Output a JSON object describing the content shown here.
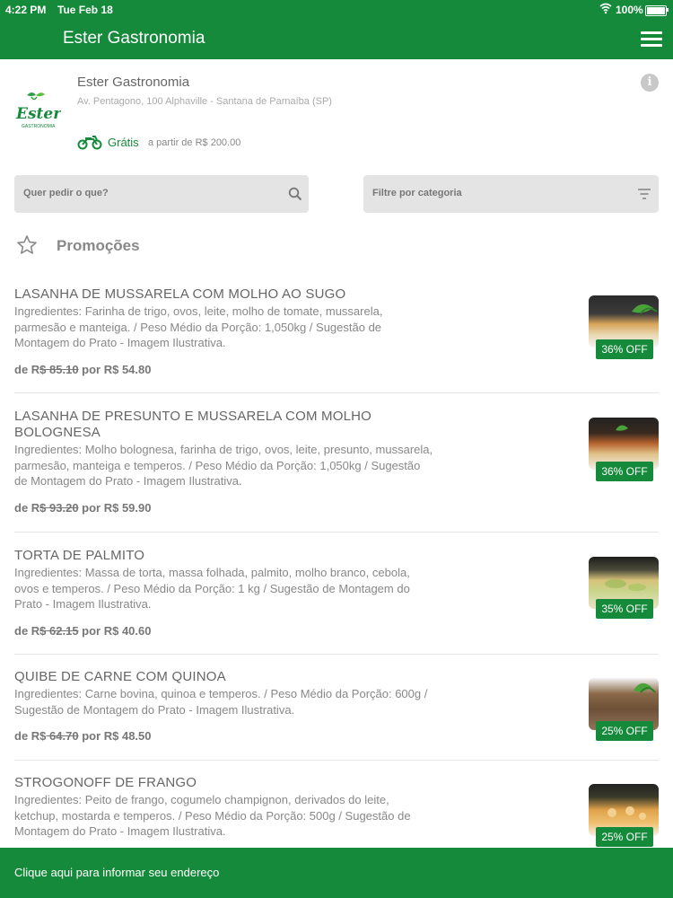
{
  "status_bar": {
    "time": "4:22 PM",
    "date": "Tue Feb 18",
    "battery": "100%"
  },
  "header": {
    "title": "Ester Gastronomia",
    "menu_icon": "hamburger-menu-icon"
  },
  "store": {
    "logo_text": "Ester",
    "logo_subtext": "GASTRONOMIA",
    "name": "Ester Gastronomia",
    "address": "Av. Pentagono, 100 Alphaville - Santana de Parnaíba (SP)",
    "delivery_label": "Grátis",
    "delivery_min": "a partir de R$ 200.00"
  },
  "search": {
    "placeholder": "Quer pedir o que?"
  },
  "filter": {
    "label": "Filtre por categoria"
  },
  "section": {
    "title": "Promoções"
  },
  "products": [
    {
      "name": "LASANHA DE MUSSARELA COM MOLHO AO SUGO",
      "description": "Ingredientes: Farinha de trigo, ovos, leite, molho de tomate, mussarela, parmesão e manteiga. / Peso Médio da Porção: 1,050kg / Sugestão de Montagem do Prato - Imagem Ilustrativa.",
      "price_prefix": "de R",
      "old_price": "$ 85.10",
      "new_price": "por R$ 54.80",
      "discount": "36% OFF"
    },
    {
      "name": "LASANHA DE PRESUNTO E MUSSARELA COM MOLHO BOLOGNESA",
      "description": "Ingredientes: Molho bolognesa, farinha de trigo, ovos, leite, presunto, mussarela, parmesão, manteiga e temperos. / Peso Médio da Porção: 1,050kg / Sugestão de Montagem do Prato - Imagem Ilustrativa.",
      "price_prefix": "de R",
      "old_price": "$ 93.20",
      "new_price": "por R$ 59.90",
      "discount": "36% OFF"
    },
    {
      "name": "TORTA DE PALMITO",
      "description": "Ingredientes: Massa de torta, massa folhada, palmito, molho branco, cebola, ovos e temperos. / Peso Médio da Porção: 1 kg / Sugestão de Montagem do Prato - Imagem Ilustrativa.",
      "price_prefix": "de R",
      "old_price": "$ 62.15",
      "new_price": "por R$ 40.60",
      "discount": "35% OFF"
    },
    {
      "name": "QUIBE DE CARNE COM QUINOA",
      "description": "Ingredientes: Carne bovina, quinoa e temperos. / Peso Médio da Porção: 600g / Sugestão de Montagem do Prato - Imagem Ilustrativa.",
      "price_prefix": "de R$",
      "old_price": " 64.70",
      "new_price": "por R$ 48.50",
      "discount": "25% OFF"
    },
    {
      "name": "STROGONOFF DE FRANGO",
      "description": "Ingredientes: Peito de frango, cogumelo champignon, derivados do leite, ketchup, mostarda e temperos. / Peso Médio da Porção: 500g / Sugestão de Montagem do Prato - Imagem Ilustrativa.",
      "price_prefix": "",
      "old_price": "",
      "new_price": "",
      "discount": "25% OFF"
    }
  ],
  "bottom_bar": {
    "label": "Clique aqui para informar seu endereço"
  },
  "colors": {
    "brand_green": "#158a3b",
    "input_bg": "#e4e4e4"
  }
}
